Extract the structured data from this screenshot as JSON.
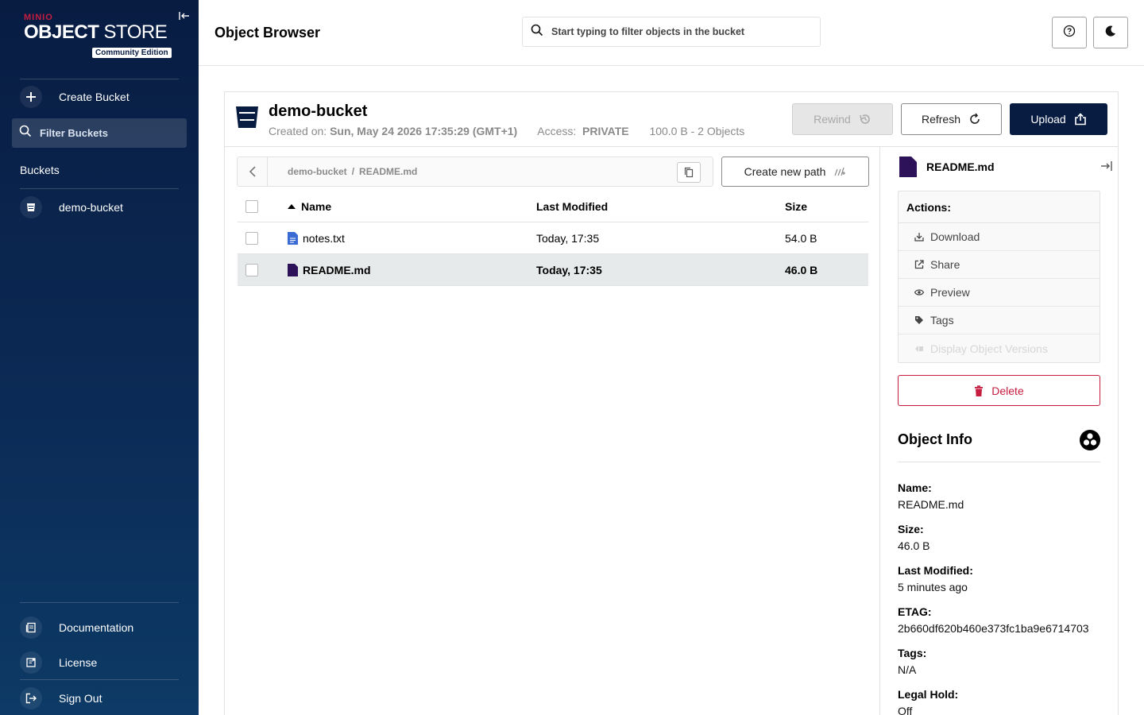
{
  "sidebar": {
    "logo": {
      "brand": "MINIO",
      "product_bold": "OBJECT",
      "product_light": "STORE",
      "edition": "Community Edition"
    },
    "create_bucket": "Create Bucket",
    "filter_placeholder": "Filter Buckets",
    "buckets_heading": "Buckets",
    "buckets": [
      {
        "name": "demo-bucket"
      }
    ],
    "footer": {
      "documentation": "Documentation",
      "license": "License",
      "sign_out": "Sign Out"
    }
  },
  "header": {
    "title": "Object Browser",
    "search_placeholder": "Start typing to filter objects in the bucket"
  },
  "bucket": {
    "name": "demo-bucket",
    "created_label": "Created on:",
    "created_value": "Sun, May 24 2026 17:35:29 (GMT+1)",
    "access_label": "Access:",
    "access_value": "PRIVATE",
    "usage": "100.0 B - 2 Objects",
    "buttons": {
      "rewind": "Rewind",
      "refresh": "Refresh",
      "upload": "Upload"
    }
  },
  "breadcrumb": {
    "bucket": "demo-bucket",
    "separator": "/",
    "object": "README.md"
  },
  "create_path_label": "Create new path",
  "table": {
    "columns": {
      "name": "Name",
      "modified": "Last Modified",
      "size": "Size"
    },
    "rows": [
      {
        "name": "notes.txt",
        "modified": "Today, 17:35",
        "size": "54.0 B",
        "icon": "text-file-icon",
        "selected": false
      },
      {
        "name": "README.md",
        "modified": "Today, 17:35",
        "size": "46.0 B",
        "icon": "file-icon",
        "selected": true
      }
    ]
  },
  "details": {
    "file_name": "README.md",
    "actions_heading": "Actions:",
    "actions": {
      "download": "Download",
      "share": "Share",
      "preview": "Preview",
      "tags": "Tags",
      "versions": "Display Object Versions"
    },
    "delete": "Delete",
    "info_title": "Object Info",
    "info": {
      "name_label": "Name:",
      "name": "README.md",
      "size_label": "Size:",
      "size": "46.0 B",
      "modified_label": "Last Modified:",
      "modified": "5 minutes ago",
      "etag_label": "ETAG:",
      "etag": "2b660df620b460e373fc1ba9e6714703",
      "tags_label": "Tags:",
      "tags": "N/A",
      "legal_hold_label": "Legal Hold:",
      "legal_hold": "Off"
    }
  },
  "colors": {
    "navy": "#081c42",
    "danger": "#c51c3f",
    "selected_row": "#e7eaea",
    "file_purple": "#2d1259",
    "file_blue": "#3a6ad4"
  }
}
